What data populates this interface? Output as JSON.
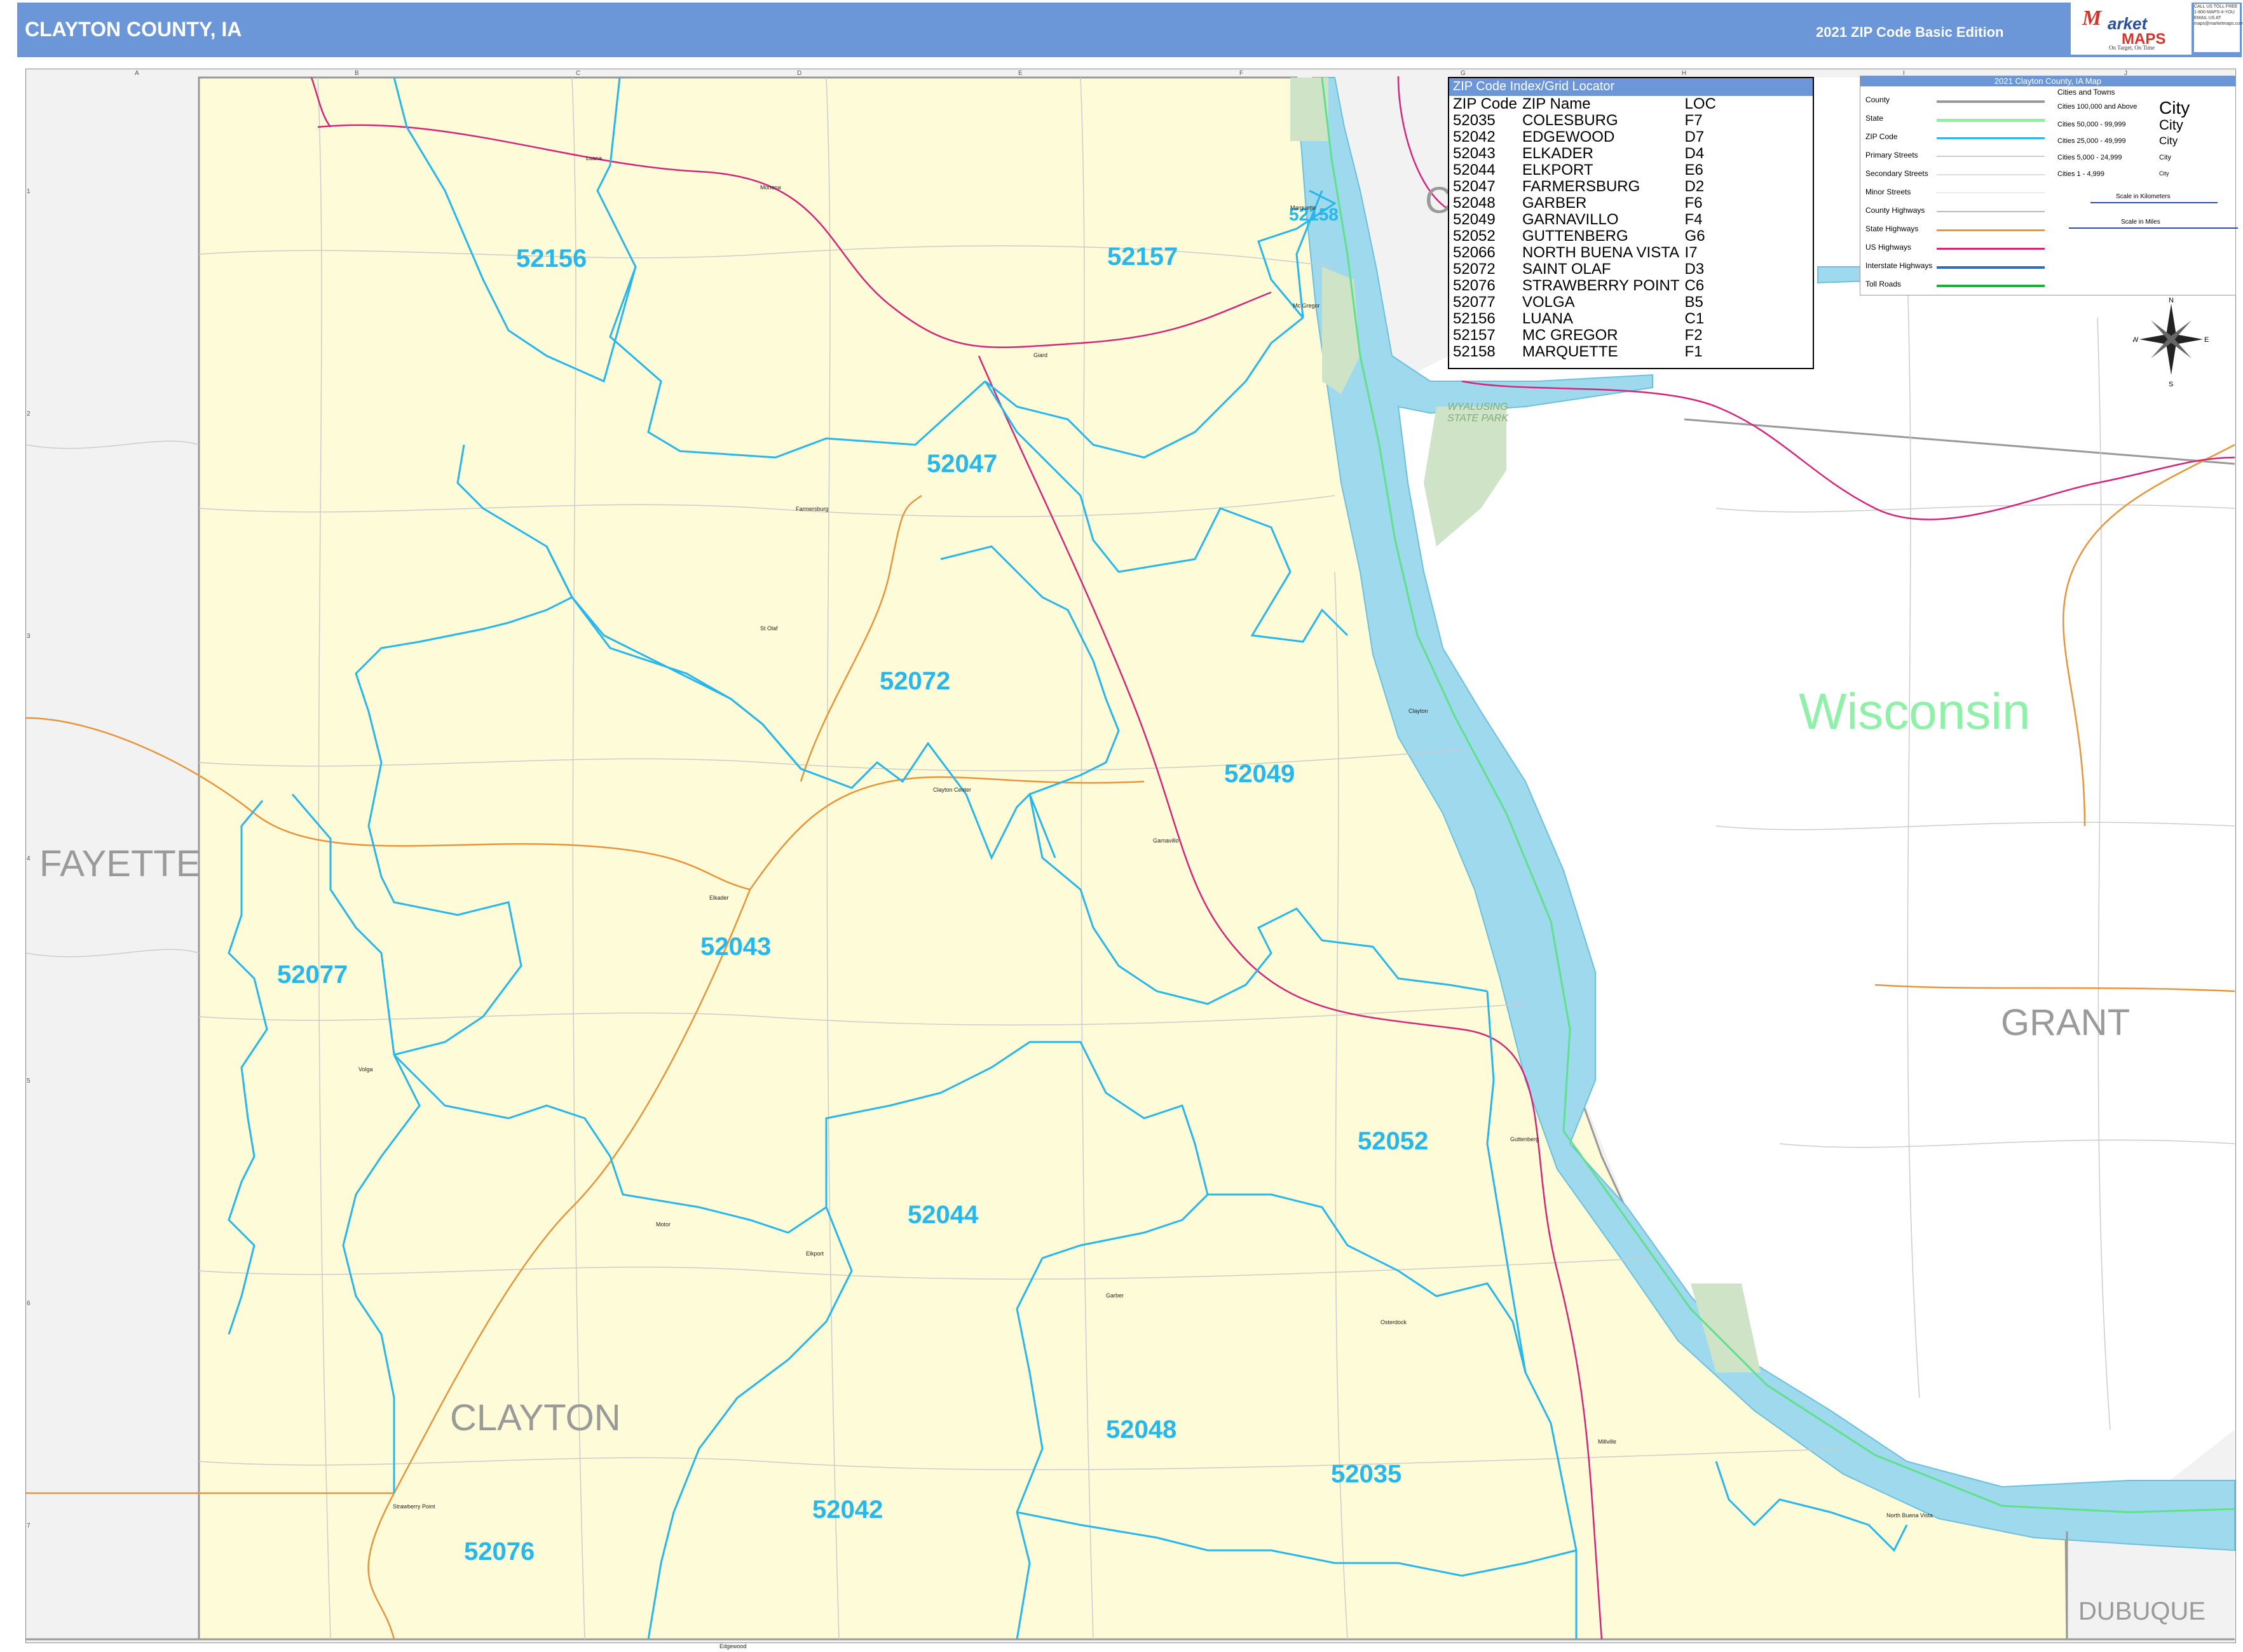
{
  "header": {
    "title": "CLAYTON COUNTY, IA",
    "edition": "2021 ZIP Code Basic Edition"
  },
  "logo": {
    "m": "M",
    "arket": "arket",
    "maps": "MAPS",
    "tagline": "On Target, On Time",
    "sub": "America's Leading Source of Business Maps",
    "contact": [
      "CALL US TOLL FREE",
      "1-800-MAPS-4-YOU",
      "EMAIL US AT",
      "maps@marketmaps.com"
    ]
  },
  "zip_index": {
    "title": "ZIP Code Index/Grid Locator",
    "columns": [
      "ZIP Code",
      "ZIP Name",
      "LOC"
    ],
    "rows": [
      [
        "52035",
        "COLESBURG",
        "F7"
      ],
      [
        "52042",
        "EDGEWOOD",
        "D7"
      ],
      [
        "52043",
        "ELKADER",
        "D4"
      ],
      [
        "52044",
        "ELKPORT",
        "E6"
      ],
      [
        "52047",
        "FARMERSBURG",
        "D2"
      ],
      [
        "52048",
        "GARBER",
        "F6"
      ],
      [
        "52049",
        "GARNAVILLO",
        "F4"
      ],
      [
        "52052",
        "GUTTENBERG",
        "G6"
      ],
      [
        "52066",
        "NORTH BUENA VISTA",
        "I7"
      ],
      [
        "52072",
        "SAINT OLAF",
        "D3"
      ],
      [
        "52076",
        "STRAWBERRY POINT",
        "C6"
      ],
      [
        "52077",
        "VOLGA",
        "B5"
      ],
      [
        "52156",
        "LUANA",
        "C1"
      ],
      [
        "52157",
        "MC GREGOR",
        "F2"
      ],
      [
        "52158",
        "MARQUETTE",
        "F1"
      ]
    ]
  },
  "legend": {
    "title": "2021 Clayton County, IA Map",
    "left_items": [
      "County",
      "State",
      "ZIP Code",
      "Primary Streets",
      "Secondary Streets",
      "Minor Streets",
      "County Highways",
      "State Highways",
      "US Highways",
      "Interstate Highways",
      "Toll Roads"
    ],
    "cities_title": "Cities and Towns",
    "city_items": [
      {
        "label": "Cities 100,000 and Above",
        "sample": "City"
      },
      {
        "label": "Cities 50,000 - 99,999",
        "sample": "City"
      },
      {
        "label": "Cities 25,000 - 49,999",
        "sample": "City"
      },
      {
        "label": "Cities 5,000 - 24,999",
        "sample": "City"
      },
      {
        "label": "Cities 1 - 4,999",
        "sample": "City"
      }
    ],
    "scale_km": "Scale in Kilometers",
    "scale_mi": "Scale in Miles",
    "colors": {
      "county": "#999999",
      "state": "#8ff0a8",
      "zip": "#27b7ea",
      "us_highway": "#d4257a",
      "state_highway": "#e8943a",
      "interstate": "#2a6ad3",
      "toll": "#1db33b"
    }
  },
  "compass": {
    "n": "N",
    "s": "S",
    "e": "E",
    "w": "W"
  },
  "zip_labels": [
    "52156",
    "52157",
    "52158",
    "52047",
    "52072",
    "52049",
    "52043",
    "52077",
    "52052",
    "52044",
    "52048",
    "52035",
    "52042",
    "52076"
  ],
  "county_labels": [
    "FAYETTE",
    "GRANT",
    "DUBUQUE",
    "CLAYTON",
    "C"
  ],
  "state_label": "Wisconsin",
  "parks": [
    "WYALUSING STATE PARK"
  ],
  "cities": [
    "Luana",
    "Monona",
    "Farmersburg",
    "St Olaf",
    "Clayton Center",
    "Elkader",
    "Garnavillo",
    "Volga",
    "Clayton",
    "Guttenberg",
    "Elkport",
    "Garber",
    "Osterdock",
    "Millville",
    "North Buena Vista",
    "Strawberry Point",
    "Edgewood",
    "Marquette",
    "Mc Gregor",
    "Giard",
    "Motor"
  ],
  "grid": {
    "cols": [
      "A",
      "B",
      "C",
      "D",
      "E",
      "F",
      "G",
      "H",
      "I",
      "J"
    ],
    "rows": [
      "1",
      "2",
      "3",
      "4",
      "5",
      "6",
      "7"
    ]
  }
}
